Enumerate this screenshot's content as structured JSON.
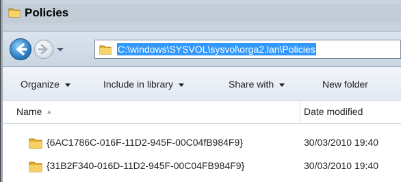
{
  "window": {
    "title": "Policies",
    "title_icon": "folder-icon"
  },
  "nav": {
    "back_icon": "back-arrow-icon",
    "forward_icon": "forward-arrow-icon",
    "recent_icon": "chevron-down-icon",
    "address_icon": "folder-icon",
    "address_value": "C:\\windows\\SYSVOL\\sysvol\\orga2.lan\\Policies"
  },
  "toolbar": {
    "organize_label": "Organize",
    "include_label": "Include in library",
    "share_label": "Share with",
    "new_folder_label": "New folder"
  },
  "columns": {
    "name_label": "Name",
    "name_sort_icon": "sort-ascending-icon",
    "date_label": "Date modified"
  },
  "files": [
    {
      "icon": "folder-icon",
      "name": "{6AC1786C-016F-11D2-945F-00C04fB984F9}",
      "date": "30/03/2010 19:40"
    },
    {
      "icon": "folder-icon",
      "name": "{31B2F340-016D-11D2-945F-00C04FB984F9}",
      "date": "30/03/2010 19:40"
    }
  ],
  "colors": {
    "selection": "#3399ff",
    "folder_yellow": "#f3c64a",
    "titlebar": "#c3cdd8"
  }
}
